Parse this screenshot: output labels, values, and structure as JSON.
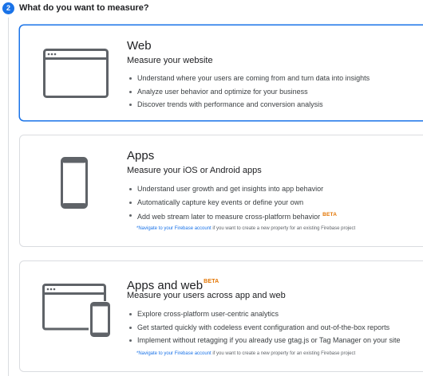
{
  "step": {
    "number": "2",
    "title": "What do you want to measure?"
  },
  "cards": [
    {
      "icon": "browser-window-icon",
      "title": "Web",
      "subtitle": "Measure your website",
      "bullets": [
        "Understand where your users are coming from and turn data into insights",
        "Analyze user behavior and optimize for your business",
        "Discover trends with performance and conversion analysis"
      ],
      "selected": true
    },
    {
      "icon": "phone-icon",
      "title": "Apps",
      "subtitle": "Measure your iOS or Android apps",
      "bullets": [
        "Understand user growth and get insights into app behavior",
        "Automatically capture key events or define your own",
        "Add web stream later to measure cross-platform behavior"
      ],
      "bullet_badge": "BETA",
      "note_link": "*Navigate to your Firebase account",
      "note_text": " if you want to create a new property for an existing Firebase project"
    },
    {
      "icon": "browser-and-phone-icon",
      "title": "Apps and web",
      "title_badge": "BETA",
      "subtitle": "Measure your users across app and web",
      "bullets": [
        "Explore cross-platform user-centric analytics",
        "Get started quickly with codeless event configuration and out-of-the-box reports",
        "Implement without retagging if you already use gtag.js or Tag Manager on your site"
      ],
      "note_link": "*Navigate to your Firebase account",
      "note_text": " if you want to create a new property for an existing Firebase project"
    }
  ],
  "colors": {
    "accent": "#1a73e8",
    "beta": "#e37400",
    "border": "#dadce0",
    "icon": "#5f6368"
  }
}
